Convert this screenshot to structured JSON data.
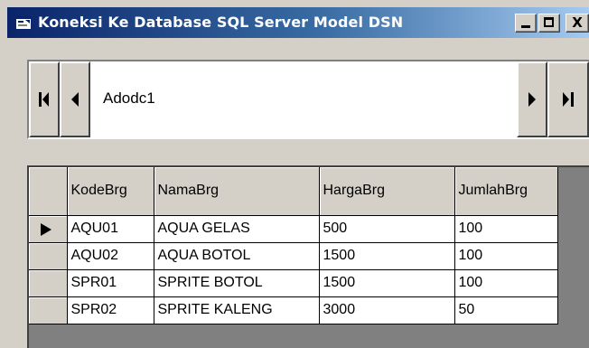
{
  "window": {
    "title": "Koneksi Ke Database SQL Server Model DSN",
    "minimize_icon": "minimize-icon",
    "maximize_icon": "maximize-icon",
    "close_label": "X",
    "title_gradient": [
      "#0a246a",
      "#a6caf0"
    ]
  },
  "adodc": {
    "caption": "Adodc1",
    "buttons": [
      "move-first-icon",
      "move-previous-icon",
      "move-next-icon",
      "move-last-icon"
    ]
  },
  "grid": {
    "columns": [
      "KodeBrg",
      "NamaBrg",
      "HargaBrg",
      "JumlahBrg"
    ],
    "rows": [
      [
        "AQU01",
        "AQUA GELAS",
        "500",
        "100"
      ],
      [
        "AQU02",
        "AQUA BOTOL",
        "1500",
        "100"
      ],
      [
        "SPR01",
        "SPRITE BOTOL",
        "1500",
        "100"
      ],
      [
        "SPR02",
        "SPRITE KALENG",
        "3000",
        "50"
      ]
    ],
    "current_row": 0
  }
}
